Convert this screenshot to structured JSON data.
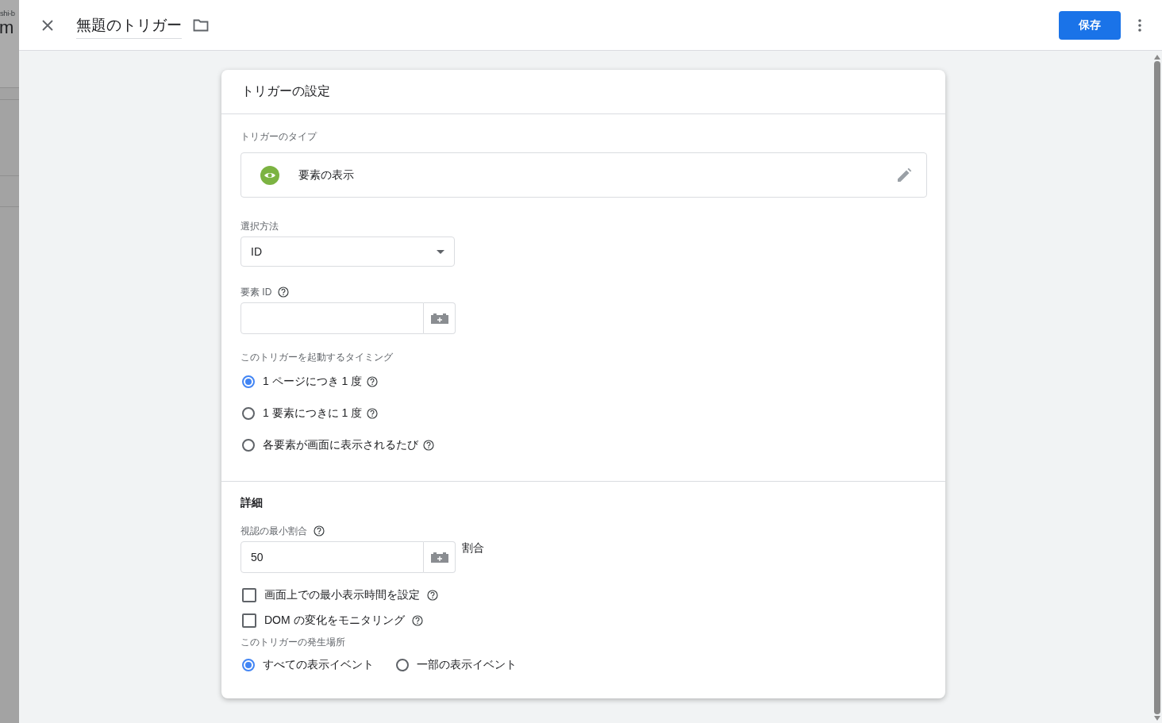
{
  "background_page": {
    "text_1": "shi-b",
    "text_2": "m"
  },
  "header": {
    "title": "無題のトリガー",
    "save_button": "保存"
  },
  "card": {
    "title": "トリガーの設定",
    "trigger_type": {
      "label": "トリガーのタイプ",
      "value": "要素の表示"
    },
    "selection_method": {
      "label": "選択方法",
      "value": "ID"
    },
    "element_id": {
      "label": "要素 ID"
    },
    "timing": {
      "label": "このトリガーを起動するタイミング",
      "options": [
        {
          "label": "1 ページにつき 1 度",
          "selected": true,
          "help": true
        },
        {
          "label": "1 要素につきに 1 度",
          "selected": false,
          "help": true
        },
        {
          "label": "各要素が画面に表示されるたび",
          "selected": false,
          "help": true
        }
      ]
    },
    "details": {
      "heading": "詳細",
      "min_percent": {
        "label": "視認の最小割合",
        "value": "50",
        "unit": "割合"
      },
      "options": [
        {
          "label": "画面上での最小表示時間を設定",
          "checked": false
        },
        {
          "label": "DOM の変化をモニタリング",
          "checked": false
        }
      ],
      "location": {
        "label": "このトリガーの発生場所",
        "options": [
          {
            "label": "すべての表示イベント",
            "selected": true,
            "help": false
          },
          {
            "label": "一部の表示イベント",
            "selected": false,
            "help": false
          }
        ]
      }
    }
  }
}
